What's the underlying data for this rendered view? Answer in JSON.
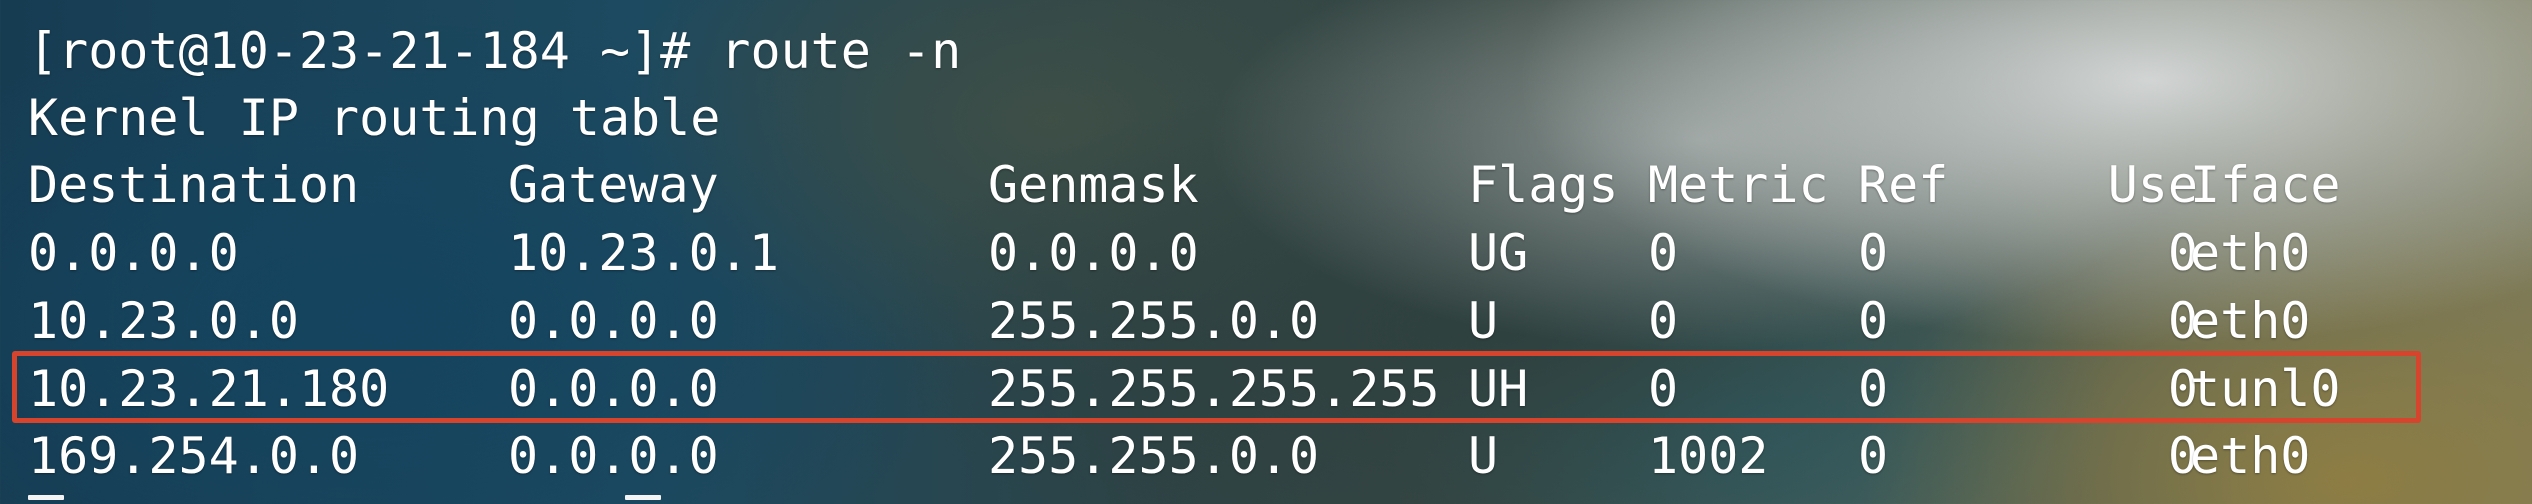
{
  "terminal": {
    "prompt": "[root@10-23-21-184 ~]# ",
    "command": "route -n",
    "table_title": "Kernel IP routing table",
    "columns": [
      "Destination",
      "Gateway",
      "Genmask",
      "Flags",
      "Metric",
      "Ref",
      "Use",
      "Iface"
    ],
    "rows": [
      {
        "destination": "0.0.0.0",
        "gateway": "10.23.0.1",
        "genmask": "0.0.0.0",
        "flags": "UG",
        "metric": "0",
        "ref": "0",
        "use": "0",
        "iface": "eth0"
      },
      {
        "destination": "10.23.0.0",
        "gateway": "0.0.0.0",
        "genmask": "255.255.0.0",
        "flags": "U",
        "metric": "0",
        "ref": "0",
        "use": "0",
        "iface": "eth0"
      },
      {
        "destination": "10.23.21.180",
        "gateway": "0.0.0.0",
        "genmask": "255.255.255.255",
        "flags": "UH",
        "metric": "0",
        "ref": "0",
        "use": "0",
        "iface": "tunl0"
      },
      {
        "destination": "169.254.0.0",
        "gateway": "0.0.0.0",
        "genmask": "255.255.0.0",
        "flags": "U",
        "metric": "1002",
        "ref": "0",
        "use": "0",
        "iface": "eth0"
      }
    ]
  },
  "colors": {
    "text": "#ffffff",
    "highlight_border": "#d6442e"
  },
  "highlighted_row_index": 2
}
